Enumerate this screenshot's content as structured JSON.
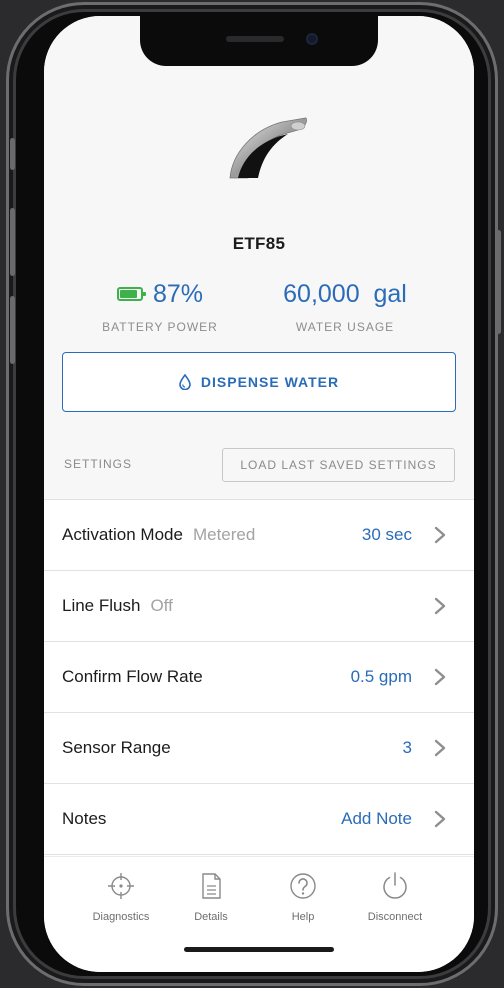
{
  "device": {
    "product_name": "ETF85",
    "battery": {
      "value": "87%",
      "label": "BATTERY POWER",
      "level_percent": 87
    },
    "water": {
      "value": "60,000  gal",
      "label": "WATER USAGE"
    }
  },
  "actions": {
    "dispense_label": "DISPENSE WATER"
  },
  "settings": {
    "section_label": "SETTINGS",
    "load_label": "LOAD LAST SAVED SETTINGS",
    "rows": [
      {
        "label": "Activation Mode",
        "sub": "Metered",
        "value": "30 sec"
      },
      {
        "label": "Line Flush",
        "sub": "Off",
        "value": ""
      },
      {
        "label": "Confirm Flow Rate",
        "sub": "",
        "value": "0.5 gpm"
      },
      {
        "label": "Sensor Range",
        "sub": "",
        "value": "3"
      },
      {
        "label": "Notes",
        "sub": "",
        "value": "Add Note"
      }
    ]
  },
  "tabs": [
    {
      "label": "Diagnostics",
      "icon": "crosshair-icon"
    },
    {
      "label": "Details",
      "icon": "document-icon"
    },
    {
      "label": "Help",
      "icon": "question-icon"
    },
    {
      "label": "Disconnect",
      "icon": "power-icon"
    }
  ],
  "colors": {
    "accent": "#2b6cb8",
    "battery": "#3db24a",
    "muted": "#8a8a8a"
  }
}
